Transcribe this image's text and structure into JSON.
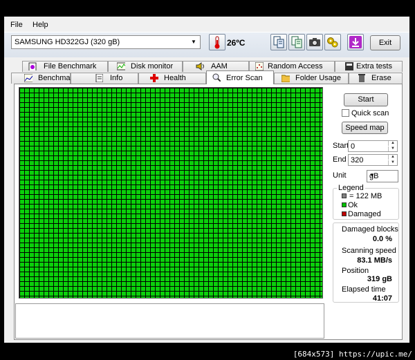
{
  "menu": {
    "file": "File",
    "help": "Help"
  },
  "toolbar": {
    "drive": "SAMSUNG HD322GJ (320 gB)",
    "temperature": "26ºC",
    "exit_label": "Exit"
  },
  "tabs_top": [
    {
      "label": "File Benchmark",
      "icon": "file-benchmark-icon"
    },
    {
      "label": "Disk monitor",
      "icon": "disk-monitor-icon"
    },
    {
      "label": "AAM",
      "icon": "speaker-icon"
    },
    {
      "label": "Random Access",
      "icon": "random-access-icon"
    },
    {
      "label": "Extra tests",
      "icon": "extra-tests-icon"
    }
  ],
  "tabs_bottom": [
    {
      "label": "Benchmark",
      "icon": "benchmark-icon"
    },
    {
      "label": "Info",
      "icon": "info-icon"
    },
    {
      "label": "Health",
      "icon": "health-icon"
    },
    {
      "label": "Error Scan",
      "icon": "error-scan-icon",
      "active": true
    },
    {
      "label": "Folder Usage",
      "icon": "folder-icon"
    },
    {
      "label": "Erase",
      "icon": "erase-icon"
    }
  ],
  "controls": {
    "start_button": "Start",
    "quick_scan": "Quick scan",
    "quick_scan_checked": false,
    "speed_map_button": "Speed map",
    "start_label": "Start",
    "start_value": "0",
    "end_label": "End",
    "end_value": "320",
    "unit_label": "Unit",
    "unit_value": "gB"
  },
  "legend": {
    "title": "Legend",
    "block_size": "= 122 MB",
    "ok": "Ok",
    "damaged": "Damaged",
    "colors": {
      "block": "#808080",
      "ok": "#00c000",
      "damaged": "#c00000"
    }
  },
  "stats": {
    "damaged_blocks_label": "Damaged blocks",
    "damaged_blocks_value": "0.0 %",
    "scanning_speed_label": "Scanning speed",
    "scanning_speed_value": "83.1 MB/s",
    "position_label": "Position",
    "position_value": "319 gB",
    "elapsed_label": "Elapsed time",
    "elapsed_value": "41:07"
  },
  "scan_grid": {
    "block_status": "ok",
    "color": "#0bd00b"
  },
  "watermark": "[684x573] https://upic.me/"
}
